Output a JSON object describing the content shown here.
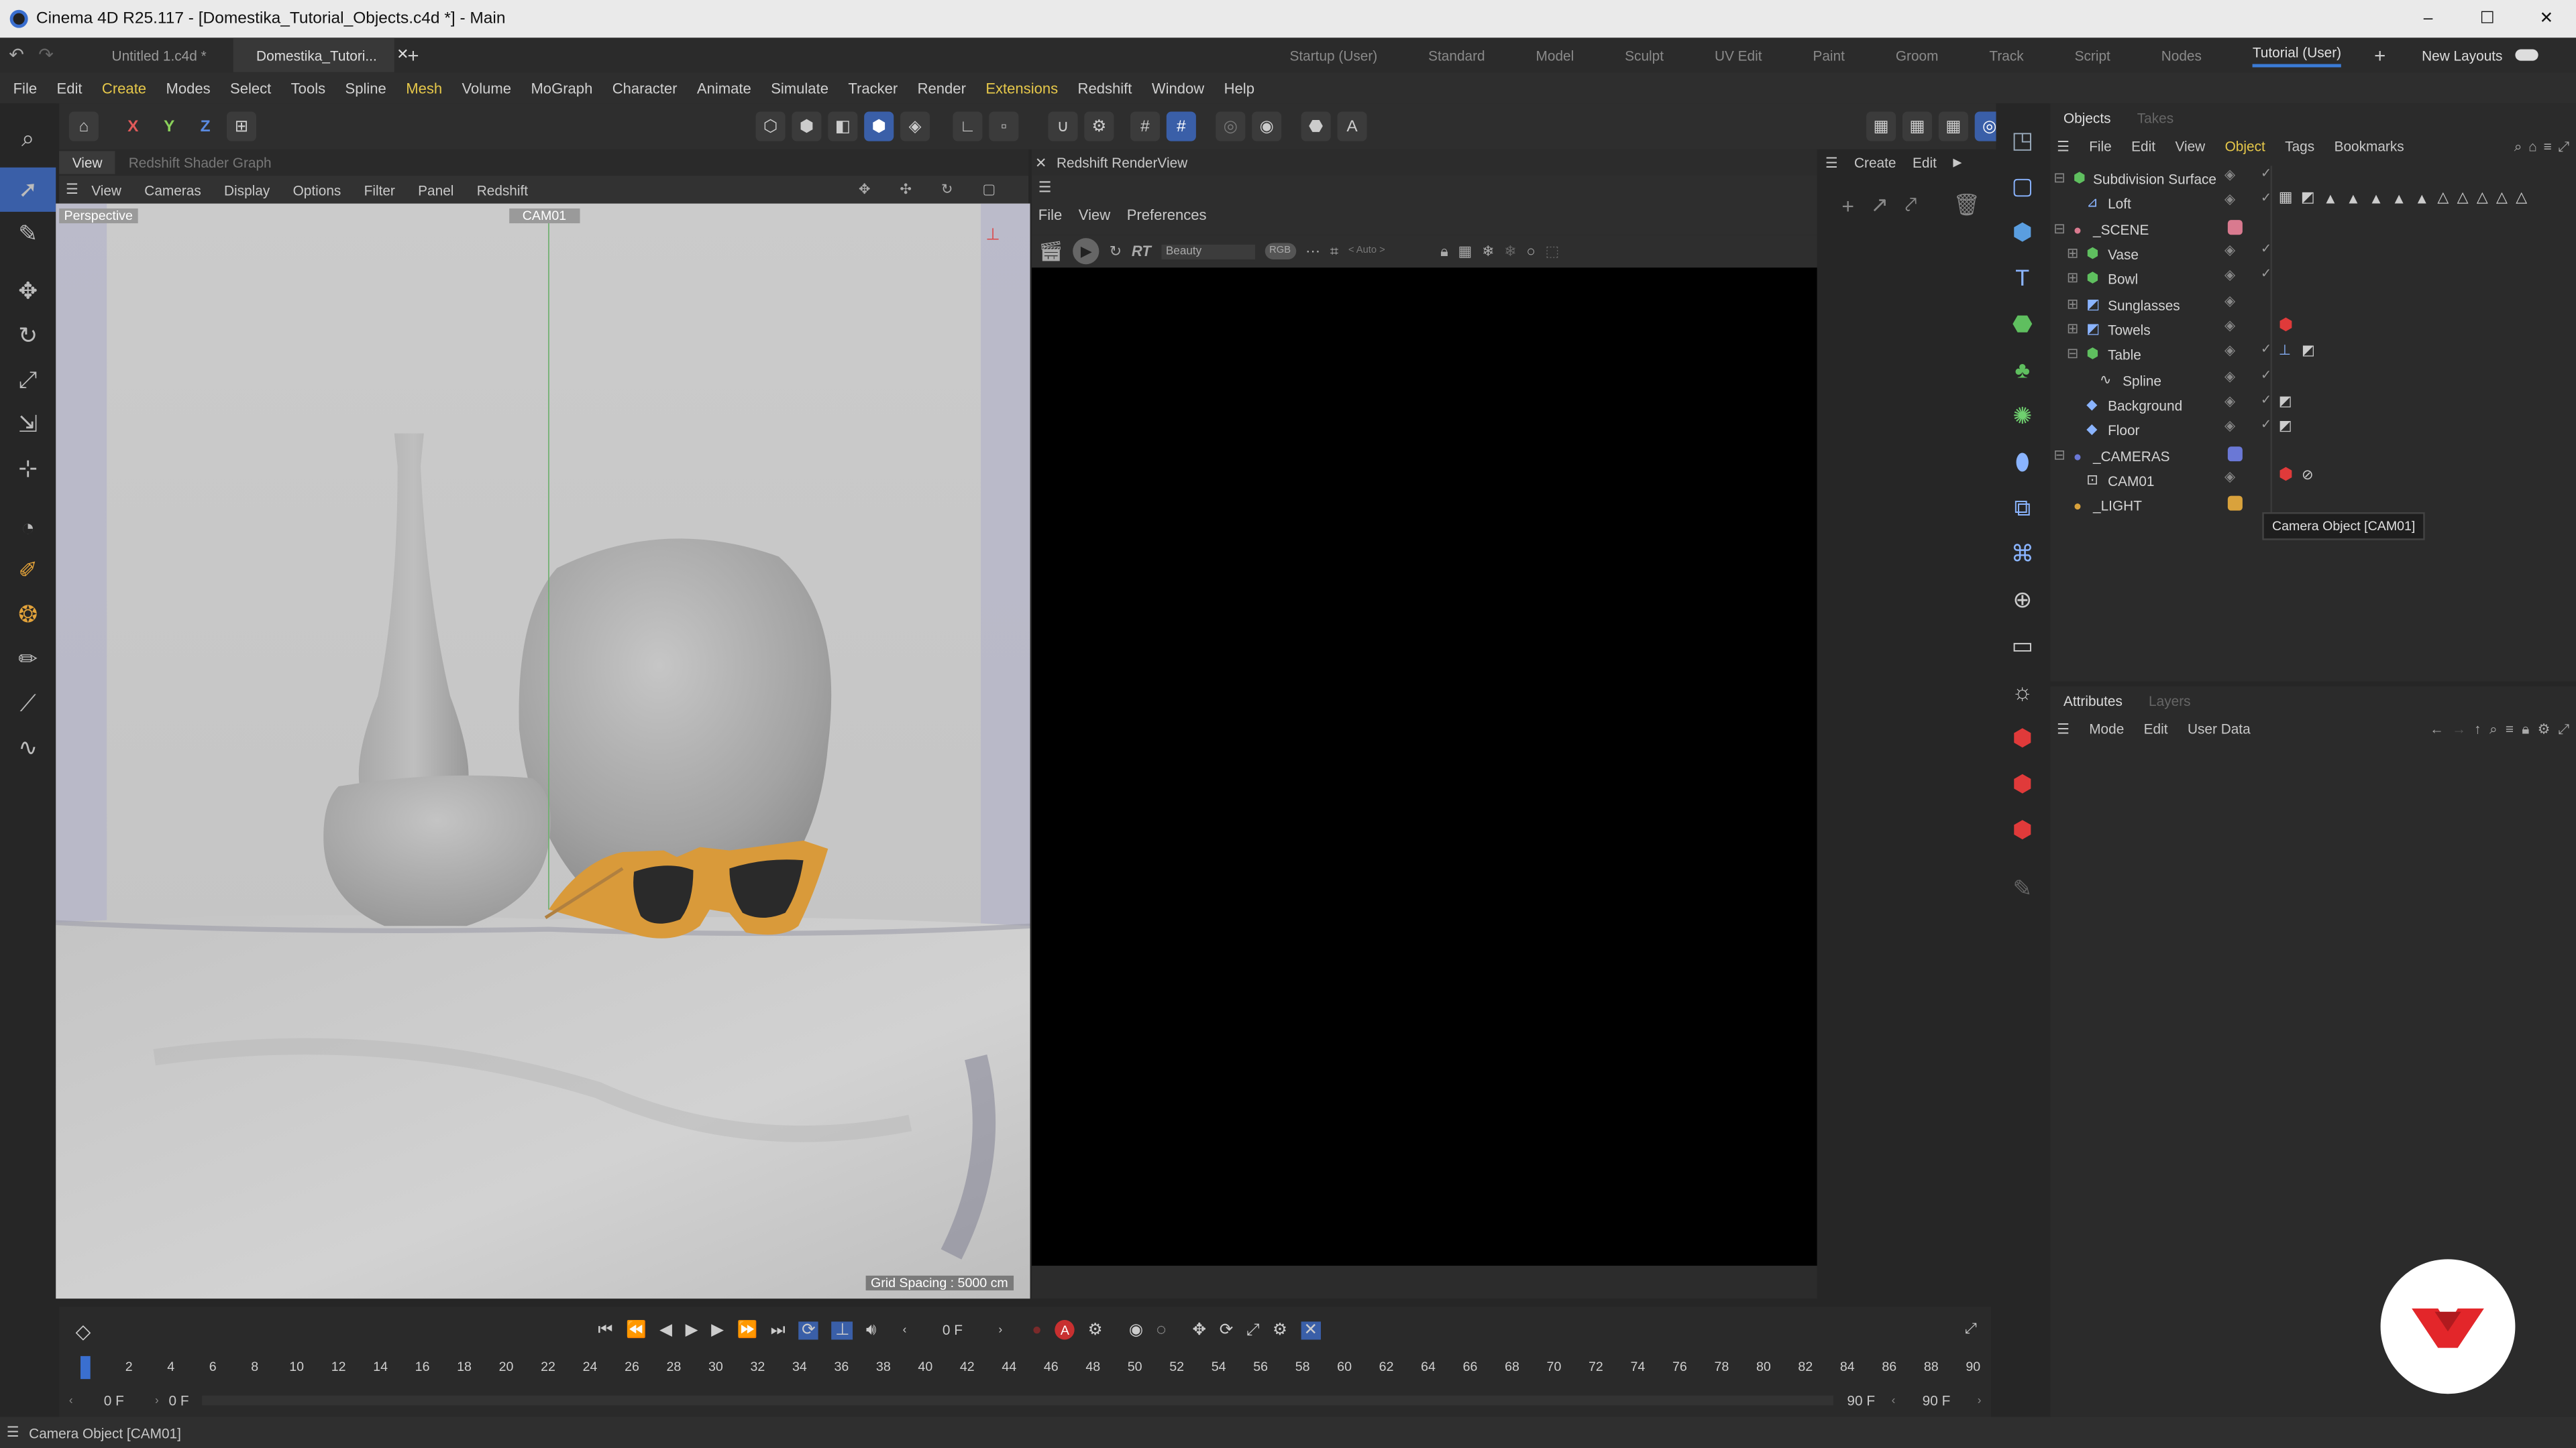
{
  "app_title": "Cinema 4D R25.117 - [Domestika_Tutorial_Objects.c4d *] - Main",
  "window_controls": {
    "minimize": "–",
    "maximize": "☐",
    "close": "✕"
  },
  "doc_tabs": [
    "Untitled 1.c4d *",
    "Domestika_Tutori..."
  ],
  "layouts": [
    "Startup (User)",
    "Standard",
    "Model",
    "Sculpt",
    "UV Edit",
    "Paint",
    "Groom",
    "Track",
    "Script",
    "Nodes",
    "Tutorial (User)"
  ],
  "active_layout": "Tutorial (User)",
  "new_layouts": "New Layouts",
  "menu": [
    "File",
    "Edit",
    "Create",
    "Modes",
    "Select",
    "Tools",
    "Spline",
    "Mesh",
    "Volume",
    "MoGraph",
    "Character",
    "Animate",
    "Simulate",
    "Tracker",
    "Render",
    "Extensions",
    "Redshift",
    "Window",
    "Help"
  ],
  "axis_buttons": [
    "X",
    "Y",
    "Z"
  ],
  "viewport": {
    "tabs": [
      "View",
      "Redshift Shader Graph"
    ],
    "menu": [
      "View",
      "Cameras",
      "Display",
      "Options",
      "Filter",
      "Panel",
      "Redshift"
    ],
    "label": "Perspective",
    "camera": "CAM01",
    "grid_spacing": "Grid Spacing : 5000 cm"
  },
  "render_view": {
    "title": "Redshift RenderView",
    "menu": [
      "File",
      "View",
      "Preferences"
    ],
    "aov": "Beauty",
    "rgb": "RGB",
    "rt": "RT",
    "auto": "< Auto >"
  },
  "create_panel": {
    "menu": [
      "Create",
      "Edit"
    ]
  },
  "objects_panel": {
    "tabs": [
      "Objects",
      "Takes"
    ],
    "menu": [
      "File",
      "Edit",
      "View",
      "Object",
      "Tags",
      "Bookmarks"
    ],
    "items": [
      {
        "name": "Subdivision Surface",
        "color": "#5fbf5f"
      },
      {
        "name": "Loft",
        "color": "#8ab4ff"
      },
      {
        "name": "_SCENE",
        "color": "#d97a8f"
      },
      {
        "name": "Vase",
        "color": "#5fbf5f"
      },
      {
        "name": "Bowl",
        "color": "#5fbf5f"
      },
      {
        "name": "Sunglasses",
        "color": "#8ab4ff"
      },
      {
        "name": "Towels",
        "color": "#8ab4ff"
      },
      {
        "name": "Table",
        "color": "#5fbf5f"
      },
      {
        "name": "Spline",
        "color": "#cccccc"
      },
      {
        "name": "Background",
        "color": "#8ab4ff"
      },
      {
        "name": "Floor",
        "color": "#8ab4ff"
      },
      {
        "name": "_CAMERAS",
        "color": "#6a78d6"
      },
      {
        "name": "CAM01",
        "color": "#cccccc"
      },
      {
        "name": "_LIGHT",
        "color": "#d9a23c"
      }
    ],
    "tooltip": "Camera Object [CAM01]"
  },
  "attributes_panel": {
    "tabs": [
      "Attributes",
      "Layers"
    ],
    "menu": [
      "Mode",
      "Edit",
      "User Data"
    ]
  },
  "timeline": {
    "ticks": [
      "0",
      "2",
      "4",
      "6",
      "8",
      "10",
      "12",
      "14",
      "16",
      "18",
      "20",
      "22",
      "24",
      "26",
      "28",
      "30",
      "32",
      "34",
      "36",
      "38",
      "40",
      "42",
      "44",
      "46",
      "48",
      "50",
      "52",
      "54",
      "56",
      "58",
      "60",
      "62",
      "64",
      "66",
      "68",
      "70",
      "72",
      "74",
      "76",
      "78",
      "80",
      "82",
      "84",
      "86",
      "88",
      "90"
    ],
    "current_frame": "0 F",
    "start": "0 F",
    "start2": "0 F",
    "end": "90 F",
    "end2": "90 F"
  },
  "status_text": "Camera Object [CAM01]"
}
